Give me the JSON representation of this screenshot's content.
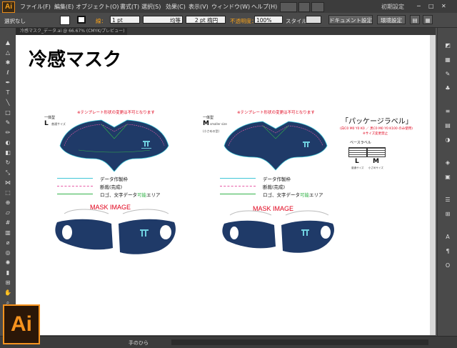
{
  "app": {
    "logo_text": "Ai"
  },
  "menu": {
    "items": [
      "ファイル(F)",
      "編集(E)",
      "オブジェクト(O)",
      "書式(T)",
      "選択(S)",
      "効果(C)",
      "表示(V)",
      "ウィンドウ(W)",
      "ヘルプ(H)"
    ],
    "workspace": "初期設定"
  },
  "control_bar": {
    "selection": "選択なし",
    "stroke_label": "線：",
    "stroke_weight": "1 pt",
    "stroke_style": "均等",
    "brush": "2 pt 楕円",
    "opacity_label": "不透明度：",
    "opacity": "100%",
    "style_label": "スタイル：",
    "doc_setup": "ドキュメント設定",
    "preferences": "環境設定"
  },
  "tab": {
    "title": "冷感マスク_データ.ai @ 66.67% (CMYK/プレビュー)"
  },
  "artboard": {
    "title": "冷感マスク",
    "notice": "※テンプレート形状の変更は不可となります",
    "left": {
      "type_label": "一体型",
      "size": "L",
      "size_note": "普通サイズ",
      "mask_image": "MASK IMAGE"
    },
    "right": {
      "type_label": "一体型",
      "size": "M",
      "size_note": "smaller size",
      "size_note2": "(小さめの型)",
      "mask_image": "MASK IMAGE"
    },
    "legend": {
      "data_frame": "データ作製枠",
      "trim": "断裁(完成)",
      "logo_area_prefix": "ロゴ、文字データ",
      "logo_area_highlight": "可能",
      "logo_area_suffix": "エリア"
    },
    "package": {
      "title": "「パッケージラベル」",
      "note1": "(白C0 M0 Y0 K0 ／ 黒C0 M0 Y0 K100 のみ使用)",
      "note2": "※サイズ変更禁止",
      "base_label": "ベースラベル",
      "size_l": "L",
      "size_m": "M",
      "size_l_note": "普通サイズ",
      "size_m_note": "小さめサイズ"
    }
  },
  "status": {
    "tool": "手のひら"
  },
  "colors": {
    "mask_navy": "#1f3a68",
    "accent_orange": "#f7931e",
    "legend_cyan": "#3fc6d6",
    "legend_pink": "#e65aa6",
    "legend_green": "#35b34a"
  }
}
